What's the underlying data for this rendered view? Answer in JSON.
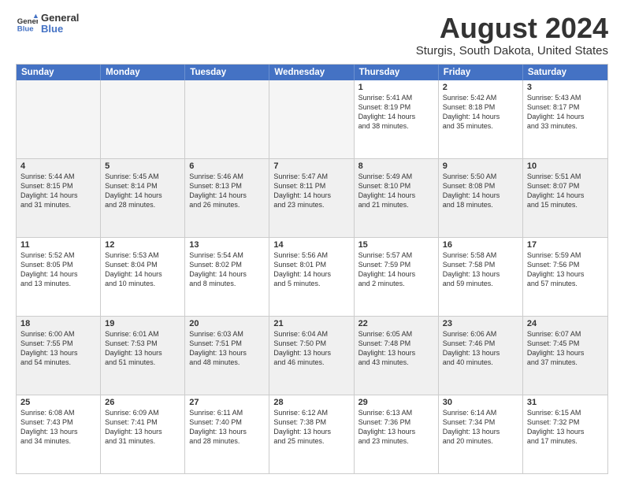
{
  "header": {
    "logo_line1": "General",
    "logo_line2": "Blue",
    "month": "August 2024",
    "location": "Sturgis, South Dakota, United States"
  },
  "weekdays": [
    "Sunday",
    "Monday",
    "Tuesday",
    "Wednesday",
    "Thursday",
    "Friday",
    "Saturday"
  ],
  "rows": [
    [
      {
        "day": "",
        "text": "",
        "empty": true
      },
      {
        "day": "",
        "text": "",
        "empty": true
      },
      {
        "day": "",
        "text": "",
        "empty": true
      },
      {
        "day": "",
        "text": "",
        "empty": true
      },
      {
        "day": "1",
        "text": "Sunrise: 5:41 AM\nSunset: 8:19 PM\nDaylight: 14 hours\nand 38 minutes."
      },
      {
        "day": "2",
        "text": "Sunrise: 5:42 AM\nSunset: 8:18 PM\nDaylight: 14 hours\nand 35 minutes."
      },
      {
        "day": "3",
        "text": "Sunrise: 5:43 AM\nSunset: 8:17 PM\nDaylight: 14 hours\nand 33 minutes."
      }
    ],
    [
      {
        "day": "4",
        "text": "Sunrise: 5:44 AM\nSunset: 8:15 PM\nDaylight: 14 hours\nand 31 minutes.",
        "shaded": true
      },
      {
        "day": "5",
        "text": "Sunrise: 5:45 AM\nSunset: 8:14 PM\nDaylight: 14 hours\nand 28 minutes.",
        "shaded": true
      },
      {
        "day": "6",
        "text": "Sunrise: 5:46 AM\nSunset: 8:13 PM\nDaylight: 14 hours\nand 26 minutes.",
        "shaded": true
      },
      {
        "day": "7",
        "text": "Sunrise: 5:47 AM\nSunset: 8:11 PM\nDaylight: 14 hours\nand 23 minutes.",
        "shaded": true
      },
      {
        "day": "8",
        "text": "Sunrise: 5:49 AM\nSunset: 8:10 PM\nDaylight: 14 hours\nand 21 minutes.",
        "shaded": true
      },
      {
        "day": "9",
        "text": "Sunrise: 5:50 AM\nSunset: 8:08 PM\nDaylight: 14 hours\nand 18 minutes.",
        "shaded": true
      },
      {
        "day": "10",
        "text": "Sunrise: 5:51 AM\nSunset: 8:07 PM\nDaylight: 14 hours\nand 15 minutes.",
        "shaded": true
      }
    ],
    [
      {
        "day": "11",
        "text": "Sunrise: 5:52 AM\nSunset: 8:05 PM\nDaylight: 14 hours\nand 13 minutes."
      },
      {
        "day": "12",
        "text": "Sunrise: 5:53 AM\nSunset: 8:04 PM\nDaylight: 14 hours\nand 10 minutes."
      },
      {
        "day": "13",
        "text": "Sunrise: 5:54 AM\nSunset: 8:02 PM\nDaylight: 14 hours\nand 8 minutes."
      },
      {
        "day": "14",
        "text": "Sunrise: 5:56 AM\nSunset: 8:01 PM\nDaylight: 14 hours\nand 5 minutes."
      },
      {
        "day": "15",
        "text": "Sunrise: 5:57 AM\nSunset: 7:59 PM\nDaylight: 14 hours\nand 2 minutes."
      },
      {
        "day": "16",
        "text": "Sunrise: 5:58 AM\nSunset: 7:58 PM\nDaylight: 13 hours\nand 59 minutes."
      },
      {
        "day": "17",
        "text": "Sunrise: 5:59 AM\nSunset: 7:56 PM\nDaylight: 13 hours\nand 57 minutes."
      }
    ],
    [
      {
        "day": "18",
        "text": "Sunrise: 6:00 AM\nSunset: 7:55 PM\nDaylight: 13 hours\nand 54 minutes.",
        "shaded": true
      },
      {
        "day": "19",
        "text": "Sunrise: 6:01 AM\nSunset: 7:53 PM\nDaylight: 13 hours\nand 51 minutes.",
        "shaded": true
      },
      {
        "day": "20",
        "text": "Sunrise: 6:03 AM\nSunset: 7:51 PM\nDaylight: 13 hours\nand 48 minutes.",
        "shaded": true
      },
      {
        "day": "21",
        "text": "Sunrise: 6:04 AM\nSunset: 7:50 PM\nDaylight: 13 hours\nand 46 minutes.",
        "shaded": true
      },
      {
        "day": "22",
        "text": "Sunrise: 6:05 AM\nSunset: 7:48 PM\nDaylight: 13 hours\nand 43 minutes.",
        "shaded": true
      },
      {
        "day": "23",
        "text": "Sunrise: 6:06 AM\nSunset: 7:46 PM\nDaylight: 13 hours\nand 40 minutes.",
        "shaded": true
      },
      {
        "day": "24",
        "text": "Sunrise: 6:07 AM\nSunset: 7:45 PM\nDaylight: 13 hours\nand 37 minutes.",
        "shaded": true
      }
    ],
    [
      {
        "day": "25",
        "text": "Sunrise: 6:08 AM\nSunset: 7:43 PM\nDaylight: 13 hours\nand 34 minutes."
      },
      {
        "day": "26",
        "text": "Sunrise: 6:09 AM\nSunset: 7:41 PM\nDaylight: 13 hours\nand 31 minutes."
      },
      {
        "day": "27",
        "text": "Sunrise: 6:11 AM\nSunset: 7:40 PM\nDaylight: 13 hours\nand 28 minutes."
      },
      {
        "day": "28",
        "text": "Sunrise: 6:12 AM\nSunset: 7:38 PM\nDaylight: 13 hours\nand 25 minutes."
      },
      {
        "day": "29",
        "text": "Sunrise: 6:13 AM\nSunset: 7:36 PM\nDaylight: 13 hours\nand 23 minutes."
      },
      {
        "day": "30",
        "text": "Sunrise: 6:14 AM\nSunset: 7:34 PM\nDaylight: 13 hours\nand 20 minutes."
      },
      {
        "day": "31",
        "text": "Sunrise: 6:15 AM\nSunset: 7:32 PM\nDaylight: 13 hours\nand 17 minutes."
      }
    ]
  ]
}
